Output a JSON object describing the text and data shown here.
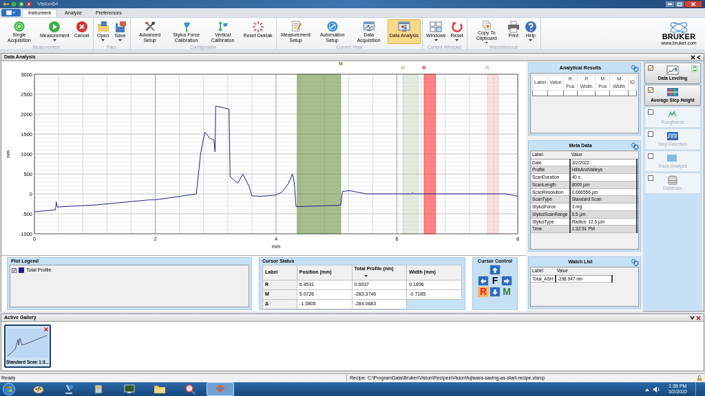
{
  "window": {
    "title": "Vision64"
  },
  "ribbon": {
    "tabs": [
      {
        "label": "Instrument",
        "selected": true
      },
      {
        "label": "Analyze",
        "selected": false
      },
      {
        "label": "Preferences",
        "selected": false
      }
    ],
    "groups": [
      {
        "title": "Measurement",
        "buttons": [
          {
            "label": "Single Acquisition",
            "dropdown": false,
            "selected": false
          },
          {
            "label": "Measurement",
            "dropdown": true,
            "selected": false
          },
          {
            "label": "Cancel",
            "dropdown": false,
            "selected": false
          }
        ]
      },
      {
        "title": "Files",
        "buttons": [
          {
            "label": "Open",
            "dropdown": true,
            "selected": false
          },
          {
            "label": "Save",
            "dropdown": true,
            "selected": false
          }
        ]
      },
      {
        "title": "Configuration",
        "buttons": [
          {
            "label": "Advanced Setup",
            "dropdown": false,
            "selected": false
          },
          {
            "label": "Stylus Force Calibration",
            "dropdown": false,
            "selected": false
          },
          {
            "label": "Vertical Calibration",
            "dropdown": false,
            "selected": false
          },
          {
            "label": "Reset Dektak",
            "dropdown": false,
            "selected": false
          }
        ]
      },
      {
        "title": "Current View",
        "buttons": [
          {
            "label": "Measurement Setup",
            "dropdown": false,
            "selected": false
          },
          {
            "label": "Automation Setup",
            "dropdown": false,
            "selected": false
          },
          {
            "label": "Data Acquisition",
            "dropdown": false,
            "selected": false
          },
          {
            "label": "Data Analysis",
            "dropdown": false,
            "selected": true
          }
        ]
      },
      {
        "title": "Current Windows",
        "buttons": [
          {
            "label": "Windows",
            "dropdown": true,
            "selected": false
          },
          {
            "label": "Reset",
            "dropdown": true,
            "selected": false
          }
        ]
      },
      {
        "title": "Miscellaneous",
        "buttons": [
          {
            "label": "Copy To Clipboard",
            "dropdown": true,
            "selected": false
          },
          {
            "label": "Print",
            "dropdown": false,
            "selected": false
          },
          {
            "label": "Help",
            "dropdown": true,
            "selected": false
          }
        ]
      }
    ]
  },
  "logo": {
    "name": "BRUKER",
    "url": "www.bruker.com"
  },
  "panel": {
    "title": "Data Analysis"
  },
  "chart": {
    "chart_data": {
      "type": "line",
      "xlabel": "mm",
      "ylabel": "nm",
      "xlim": [
        0,
        8
      ],
      "ylim": [
        -1000,
        3000
      ],
      "xticks": [
        0,
        2,
        4,
        6,
        8
      ],
      "yticks": [
        -1000,
        -500,
        0,
        500,
        1000,
        1500,
        2000,
        2500,
        3000
      ],
      "x": [
        0,
        0.35,
        0.36,
        0.38,
        1,
        1.9,
        2,
        2.6,
        2.68,
        2.75,
        2.82,
        2.9,
        2.97,
        2.99,
        3,
        3.22,
        3.24,
        3.3,
        3.37,
        3.45,
        3.55,
        3.6,
        3.75,
        4,
        4.1,
        4.2,
        4.27,
        4.3,
        4.33,
        5,
        5.07,
        5.1,
        5.22,
        5.5,
        6,
        6.25,
        6.26,
        6.27,
        7.8,
        8
      ],
      "series": [
        {
          "name": "Total Profile",
          "color": "#1f1f8f",
          "values": [
            -450,
            -400,
            -200,
            -330,
            -280,
            -150,
            -150,
            -20,
            0,
            1000,
            1550,
            1400,
            1350,
            1050,
            2200,
            2130,
            430,
            350,
            270,
            500,
            200,
            -50,
            -60,
            -30,
            50,
            250,
            500,
            300,
            -320,
            -290,
            -280,
            60,
            80,
            0,
            0,
            0,
            30,
            0,
            0,
            -60
          ]
        }
      ],
      "grid": true,
      "bands": [
        {
          "axis": "x",
          "from": 4.35,
          "to": 5.07,
          "label": "M",
          "color": "#5f8a30"
        },
        {
          "axis": "x",
          "from": 6.1,
          "to": 6.35,
          "label": "M",
          "color": "#a9bf94"
        },
        {
          "axis": "x",
          "from": 6.45,
          "to": 6.64,
          "label": "R",
          "color": "#ff2020"
        },
        {
          "axis": "x",
          "from": 7.5,
          "to": 7.68,
          "label": "R",
          "color": "#f4a0a0"
        }
      ]
    }
  },
  "plot_legend": {
    "title": "Plot Legend",
    "items": [
      {
        "checked": true
      }
    ]
  },
  "cursor_status": {
    "title": "Cursor Status",
    "columns": [
      "Label",
      "Position (mm)",
      "Total Profile (nm)",
      "Width (mm)"
    ],
    "rows": [
      [
        "R",
        "6.4531",
        "0.6937",
        "0.1896"
      ],
      [
        "M",
        "5.0726",
        "-283.3746",
        "-0.7185"
      ],
      [
        "Δ",
        "-1.3805",
        "-284.0683"
      ]
    ]
  },
  "cursor_control": {
    "title": "Cursor Control",
    "buttons": [
      {
        "kind": "blank"
      },
      {
        "kind": "up"
      },
      {
        "kind": "blank"
      },
      {
        "kind": "left"
      },
      {
        "kind": "text",
        "label": "F",
        "selected": false
      },
      {
        "kind": "right"
      },
      {
        "kind": "text",
        "label": "R",
        "selected": true
      },
      {
        "kind": "down"
      },
      {
        "kind": "text",
        "label": "M",
        "selected": false
      }
    ]
  },
  "analytical_results": {
    "title": "Analytical Results",
    "columns": [
      "Label",
      "Value",
      "R Pos",
      "R Width",
      "M Pos",
      "M Width",
      "ID"
    ]
  },
  "meta_data": {
    "title": "Meta Data",
    "columns": [
      "Label",
      "Value"
    ],
    "rows": [
      [
        "Date",
        "3/2/2022"
      ],
      [
        "Profile",
        "HillsAndValleys"
      ],
      [
        "ScanDuration",
        "40 s"
      ],
      [
        "ScanLength",
        "8000 µm"
      ],
      [
        "ScanResolution",
        "0.666556 µm"
      ],
      [
        "ScanType",
        "Standard Scan"
      ],
      [
        "StylusForce",
        "3 mg"
      ],
      [
        "StylusScanRange",
        "6.5 µm"
      ],
      [
        "StylusType",
        "Radius: 12.5 µm"
      ],
      [
        "Time",
        "1:32:51 PM"
      ]
    ]
  },
  "watch_list": {
    "title": "Watch List",
    "columns": [
      "Label",
      "Value"
    ],
    "rows": [
      [
        "Total_ASH",
        "-298.947 nm"
      ]
    ]
  },
  "tools": [
    {
      "label": "Data Leveling",
      "checked": true,
      "refresh": true
    },
    {
      "label": "Average Step Height",
      "checked": true,
      "refresh": false
    },
    {
      "label": "Roughness",
      "checked": false,
      "refresh": false
    },
    {
      "label": "Step Detection",
      "checked": false,
      "refresh": false
    },
    {
      "label": "Trace Analysis",
      "checked": false,
      "refresh": false
    },
    {
      "label": "Database",
      "checked": false,
      "refresh": false
    }
  ],
  "gallery": {
    "title": "Active Gallery",
    "items": [
      {
        "label": "Standard Scan 1:3...",
        "selected": true
      }
    ]
  },
  "status_bar": {
    "status": "Ready",
    "recipe": "Recipe: C:\\ProgramData\\Bruker\\Vision\\Recipes\\Vision\\fujiwara-saving-as-start-recipe.visrcp"
  },
  "taskbar": {
    "apps": [
      {
        "selected": false
      },
      {
        "selected": false
      },
      {
        "selected": false
      },
      {
        "selected": false
      },
      {
        "selected": false
      },
      {
        "selected": false
      },
      {
        "selected": true
      }
    ],
    "time": "1:35 PM",
    "date": "3/2/2022"
  }
}
